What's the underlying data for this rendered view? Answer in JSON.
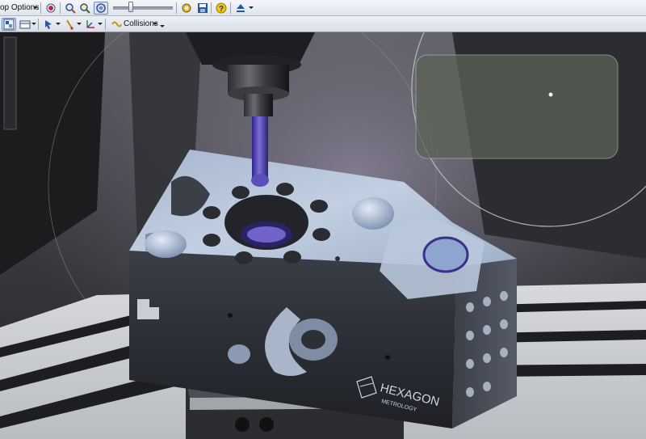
{
  "toolbar": {
    "shop_options_label": "op Options",
    "collisions_label": "Collisions",
    "slider_value": 0.3
  },
  "icons": {
    "toolbar_top": [
      "record-icon",
      "zoom-icon",
      "fly-icon",
      "fit-view-icon",
      "settings-gear-icon",
      "save-icon",
      "help-icon",
      "eject-icon"
    ],
    "toolbar_second": [
      "view-grid-icon",
      "layout-icon",
      "pointer-icon",
      "probe-icon",
      "axis-icon",
      "collisions-icon"
    ]
  },
  "viewport": {
    "logo_text": "HEXAGON",
    "logo_subtext": "METROLOGY"
  },
  "colors": {
    "accent": "#6d8bbd",
    "probe_stylus": "#5a4fb8",
    "part_top": "#b8c6dc",
    "part_side": "#2a2d33",
    "table": "#c9ccd1"
  }
}
